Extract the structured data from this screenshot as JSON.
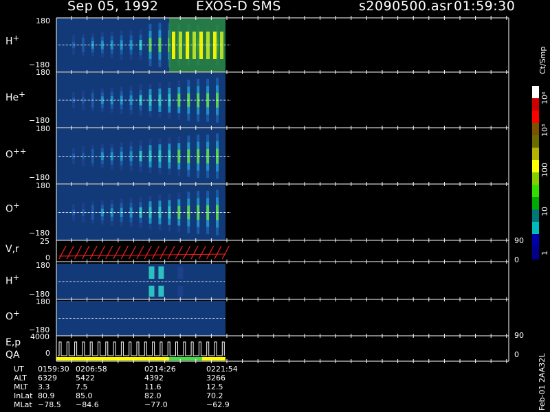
{
  "header": {
    "date": "Sep 05, 1992",
    "mission": "EXOS-D SMS",
    "file": "s2090500.asr",
    "time": "01:59:30"
  },
  "panels": [
    {
      "label": "H",
      "charge": "+",
      "top_tick": "180",
      "bottom_tick": "−180"
    },
    {
      "label": "He",
      "charge": "+",
      "top_tick": "180",
      "bottom_tick": "−180"
    },
    {
      "label": "O",
      "charge": "++",
      "top_tick": "180",
      "bottom_tick": "−180"
    },
    {
      "label": "O",
      "charge": "+",
      "top_tick": "180",
      "bottom_tick": "−180"
    },
    {
      "label": "V,r",
      "charge": "",
      "top_tick": "25",
      "bottom_tick": "0",
      "right_top": "90",
      "right_bottom": "0"
    },
    {
      "label": "H",
      "charge": "+",
      "top_tick": "180",
      "bottom_tick": "−180"
    },
    {
      "label": "O",
      "charge": "+",
      "top_tick": "180",
      "bottom_tick": "−180"
    },
    {
      "label": "E,p",
      "charge": "",
      "top_tick": "4000",
      "bottom_tick": "0",
      "right_top": "90",
      "right_bottom": "0"
    }
  ],
  "qa_label": "QA",
  "colorbar": {
    "unit": "Ct/Smp",
    "ticks": [
      "10⁴",
      "10³",
      "100",
      "10",
      "1"
    ],
    "colors": [
      "#ffffff",
      "#cc0000",
      "#ff0000",
      "#7a5200",
      "#6b6b00",
      "#b4b400",
      "#ffff00",
      "#88cc00",
      "#33dd00",
      "#00aa00",
      "#007777",
      "#00bbbb",
      "#0000aa",
      "#000088"
    ]
  },
  "footer": {
    "rows": [
      {
        "label": "UT",
        "values": [
          "0159:30",
          "0206:58",
          "0214:26",
          "0221:54"
        ]
      },
      {
        "label": "ALT",
        "values": [
          "6329",
          "5422",
          "4392",
          "3266"
        ]
      },
      {
        "label": "MLT",
        "values": [
          "3.3",
          "7.5",
          "11.6",
          "12.5"
        ]
      },
      {
        "label": "InLat",
        "values": [
          "80.9",
          "85.0",
          "82.0",
          "70.2"
        ]
      },
      {
        "label": "MLat",
        "values": [
          "−78.5",
          "−84.6",
          "−77.0",
          "−62.9"
        ]
      }
    ],
    "side_note": "Feb-01 2AA32L"
  },
  "chart_data": {
    "type": "heatmap",
    "title": "Sep 05, 1992   EXOS-D SMS",
    "x_axis_time_ticks": [
      "0159:30",
      "0206:58",
      "0214:26",
      "0221:54"
    ],
    "pitch_angle_range": [
      -180,
      180
    ],
    "series": [
      {
        "name": "H+",
        "values": [
          0.3,
          0.35,
          0.4,
          0.45,
          0.5,
          0.55,
          0.55,
          0.6,
          0.9,
          0.95,
          0.95,
          0.9,
          0.9,
          0.85,
          0.8,
          0.85
        ]
      },
      {
        "name": "He+",
        "values": [
          0.2,
          0.3,
          0.35,
          0.4,
          0.45,
          0.5,
          0.55,
          0.6,
          0.65,
          0.7,
          0.75,
          0.8,
          0.85,
          0.9,
          0.9,
          0.95
        ]
      },
      {
        "name": "O++",
        "values": [
          0.2,
          0.3,
          0.35,
          0.4,
          0.45,
          0.5,
          0.55,
          0.6,
          0.65,
          0.7,
          0.75,
          0.8,
          0.85,
          0.9,
          0.9,
          0.95
        ]
      },
      {
        "name": "O+",
        "values": [
          0.2,
          0.3,
          0.35,
          0.4,
          0.45,
          0.5,
          0.55,
          0.6,
          0.65,
          0.7,
          0.75,
          0.8,
          0.85,
          0.9,
          0.9,
          0.95
        ]
      },
      {
        "name": "H+ (lower)",
        "values": [
          0,
          0,
          0,
          0,
          0,
          0,
          0,
          0,
          0.5,
          0.6,
          0,
          0.15,
          0,
          0,
          0,
          0
        ]
      },
      {
        "name": "O+ (lower)",
        "values": [
          0,
          0,
          0,
          0,
          0,
          0,
          0,
          0,
          0,
          0,
          0,
          0,
          0,
          0,
          0,
          0
        ]
      }
    ]
  }
}
